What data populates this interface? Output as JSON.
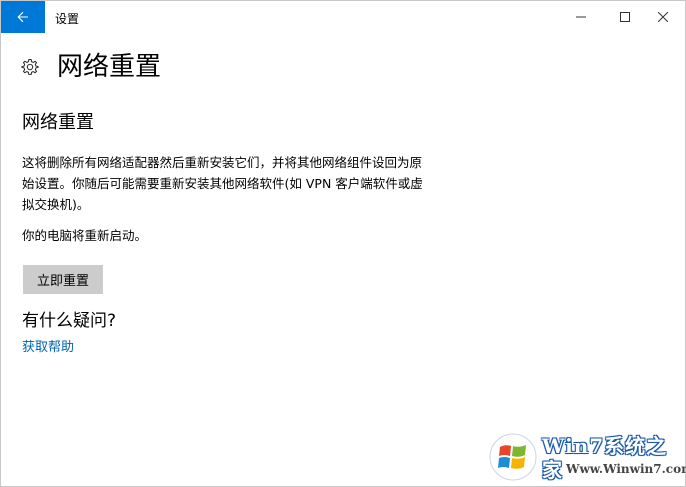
{
  "window": {
    "app_title": "设置",
    "back_icon": "back-arrow-icon",
    "controls": [
      "minimize-icon",
      "maximize-icon",
      "close-icon"
    ],
    "accent_color": "#0078d7"
  },
  "page": {
    "title": "网络重置",
    "icon": "gear-icon"
  },
  "section": {
    "title": "网络重置",
    "description": "这将删除所有网络适配器然后重新安装它们，并将其他网络组件设回为原始设置。你随后可能需要重新安装其他网络软件(如 VPN 客户端软件或虚拟交换机)。",
    "restart_note": "你的电脑将重新启动。",
    "reset_button_label": "立即重置"
  },
  "faq": {
    "title": "有什么疑问?",
    "help_link": "获取帮助",
    "link_color": "#0063b1"
  },
  "watermark": {
    "brand": "Win7系统之家",
    "site": "Www.Winwin7.com"
  }
}
